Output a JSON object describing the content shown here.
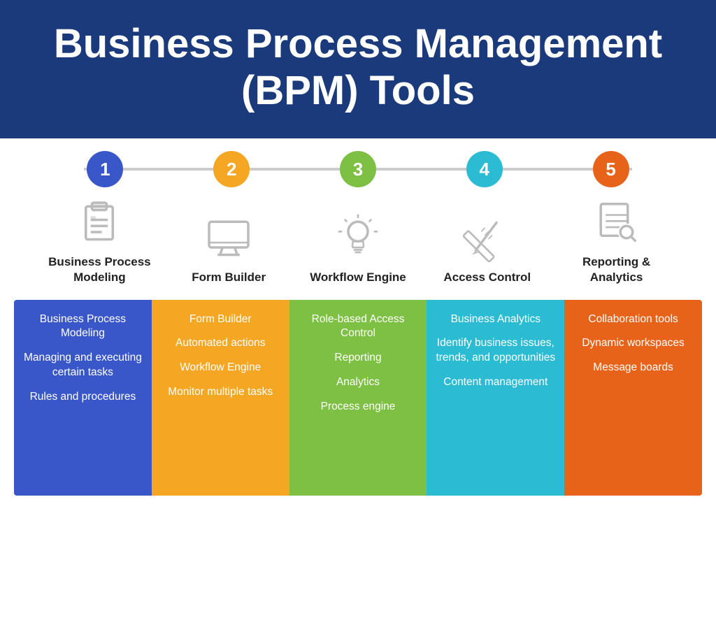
{
  "header": {
    "title": "Business Process Management (BPM) Tools"
  },
  "columns": [
    {
      "number": "1",
      "numClass": "num-1",
      "iconType": "clipboard",
      "label": "Business Process\nModeling",
      "items": [
        "Business Process Modeling",
        "Managing and executing certain tasks",
        "Rules and procedures"
      ]
    },
    {
      "number": "2",
      "numClass": "num-2",
      "iconType": "monitor",
      "label": "Form Builder",
      "items": [
        "Form Builder",
        "Automated actions",
        "Workflow Engine",
        "Monitor multiple tasks"
      ]
    },
    {
      "number": "3",
      "numClass": "num-3",
      "iconType": "lightbulb",
      "label": "Workflow Engine",
      "items": [
        "Role-based Access Control",
        "Reporting",
        "Analytics",
        "Process engine"
      ]
    },
    {
      "number": "4",
      "numClass": "num-4",
      "iconType": "tools",
      "label": "Access Control",
      "items": [
        "Business Analytics",
        "Identify business issues, trends, and opportunities",
        "Content management"
      ]
    },
    {
      "number": "5",
      "numClass": "num-5",
      "iconType": "chart",
      "label": "Reporting &\nAnalytics",
      "items": [
        "Collaboration tools",
        "Dynamic workspaces",
        "Message boards"
      ]
    }
  ]
}
